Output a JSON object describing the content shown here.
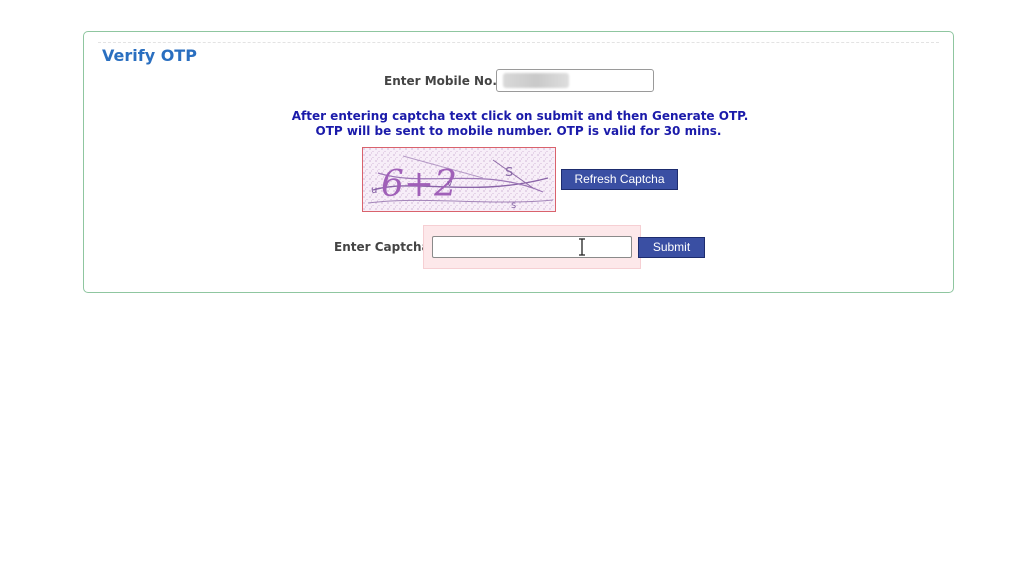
{
  "form": {
    "title": "Verify OTP",
    "mobile_label": "Enter Mobile No. :",
    "mobile_value_redacted": true,
    "notice_line1": "After entering captcha text click on submit and then Generate OTP.",
    "notice_line2": "OTP will be sent to mobile number. OTP is valid for 30 mins.",
    "captcha_image_text": "6+2",
    "refresh_label": "Refresh Captcha",
    "captcha_label": "Enter Captcha :",
    "captcha_value": "",
    "submit_label": "Submit"
  },
  "colors": {
    "title": "#2a6fc0",
    "notice": "#1b1baa",
    "button_bg": "#3a4fa3",
    "panel_border": "#8fc6a0",
    "captcha_border": "#d9626c"
  },
  "icons": {
    "cursor": "text-cursor-icon"
  }
}
